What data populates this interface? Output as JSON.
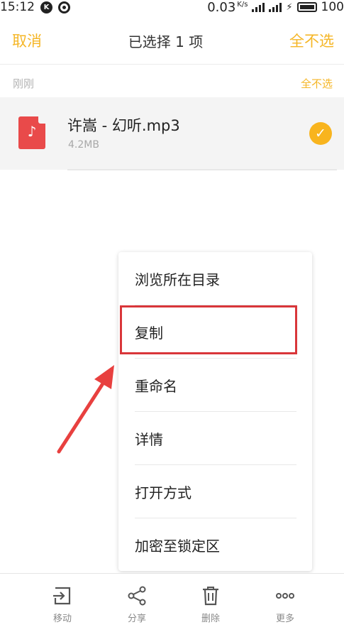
{
  "status_bar": {
    "time": "15:12",
    "speed": "0.03",
    "speed_unit": "K/s",
    "battery": "100",
    "icons": [
      "k-icon",
      "signal-ring-icon",
      "signal-bars-icon",
      "signal-bars-icon",
      "charging-icon",
      "battery-icon"
    ]
  },
  "header": {
    "cancel_label": "取消",
    "title": "已选择 1 项",
    "deselect_all_label": "全不选"
  },
  "section": {
    "label": "刚刚",
    "deselect_all_label": "全不选"
  },
  "file": {
    "name": "许嵩 - 幻听.mp3",
    "size": "4.2MB",
    "icon": "music-file-icon",
    "selected": true,
    "colors": {
      "icon": "#e94a4a",
      "check": "#f8b41e"
    }
  },
  "context_menu": {
    "items": [
      {
        "label": "浏览所在目录"
      },
      {
        "label": "复制"
      },
      {
        "label": "重命名"
      },
      {
        "label": "详情"
      },
      {
        "label": "打开方式"
      },
      {
        "label": "加密至锁定区"
      }
    ],
    "highlighted_item": "复制",
    "highlight_color": "#d9363a"
  },
  "bottom_bar": {
    "tools": [
      {
        "label": "移动",
        "icon": "move-icon"
      },
      {
        "label": "分享",
        "icon": "share-icon"
      },
      {
        "label": "删除",
        "icon": "delete-icon"
      },
      {
        "label": "更多",
        "icon": "more-icon"
      }
    ]
  },
  "accent_color": "#f5b626"
}
